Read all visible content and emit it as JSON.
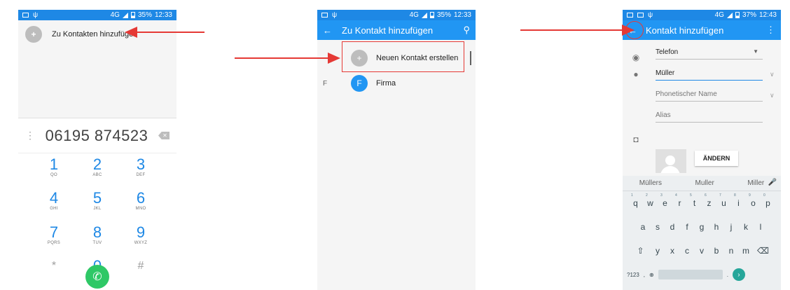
{
  "statusbar": {
    "p1": {
      "network": "4G",
      "battery": "35%",
      "time": "12:33"
    },
    "p2": {
      "network": "4G",
      "battery": "35%",
      "time": "12:33"
    },
    "p3": {
      "network": "4G",
      "battery": "37%",
      "time": "12:43"
    }
  },
  "dialer": {
    "add_to_contacts_label": "Zu Kontakten hinzufügen",
    "number": "06195 874523",
    "keys": [
      {
        "digit": "1",
        "sub": "QO"
      },
      {
        "digit": "2",
        "sub": "ABC"
      },
      {
        "digit": "3",
        "sub": "DEF"
      },
      {
        "digit": "4",
        "sub": "GHI"
      },
      {
        "digit": "5",
        "sub": "JKL"
      },
      {
        "digit": "6",
        "sub": "MNO"
      },
      {
        "digit": "7",
        "sub": "PQRS"
      },
      {
        "digit": "8",
        "sub": "TUV"
      },
      {
        "digit": "9",
        "sub": "WXYZ"
      },
      {
        "digit": "*",
        "sub": ""
      },
      {
        "digit": "0",
        "sub": "+"
      },
      {
        "digit": "#",
        "sub": ""
      }
    ]
  },
  "add_to_contact": {
    "title": "Zu Kontakt hinzufügen",
    "new_contact_label": "Neuen Kontakt erstellen",
    "section_letter": "F",
    "firma_initial": "F",
    "firma_label": "Firma"
  },
  "new_contact": {
    "title": "Kontakt hinzufügen",
    "account_field": "Telefon",
    "name_value": "Müller",
    "phonetic_placeholder": "Phonetischer Name",
    "alias_placeholder": "Alias",
    "change_button": "ÄNDERN",
    "suggestions": [
      "Müllers",
      "Muller",
      "Miller"
    ],
    "row1": [
      "q",
      "w",
      "e",
      "r",
      "t",
      "z",
      "u",
      "i",
      "o",
      "p"
    ],
    "row1_nums": [
      "1",
      "2",
      "3",
      "4",
      "5",
      "6",
      "7",
      "8",
      "9",
      "0"
    ],
    "row2": [
      "a",
      "s",
      "d",
      "f",
      "g",
      "h",
      "j",
      "k",
      "l"
    ],
    "row3": [
      "y",
      "x",
      "c",
      "v",
      "b",
      "n",
      "m"
    ],
    "sym_key": "?123",
    "comma_key": ",",
    "period_key": "."
  },
  "colors": {
    "accent": "#2196f3",
    "status": "#1e88e5",
    "arrow": "#e53935",
    "call": "#2ec866"
  }
}
